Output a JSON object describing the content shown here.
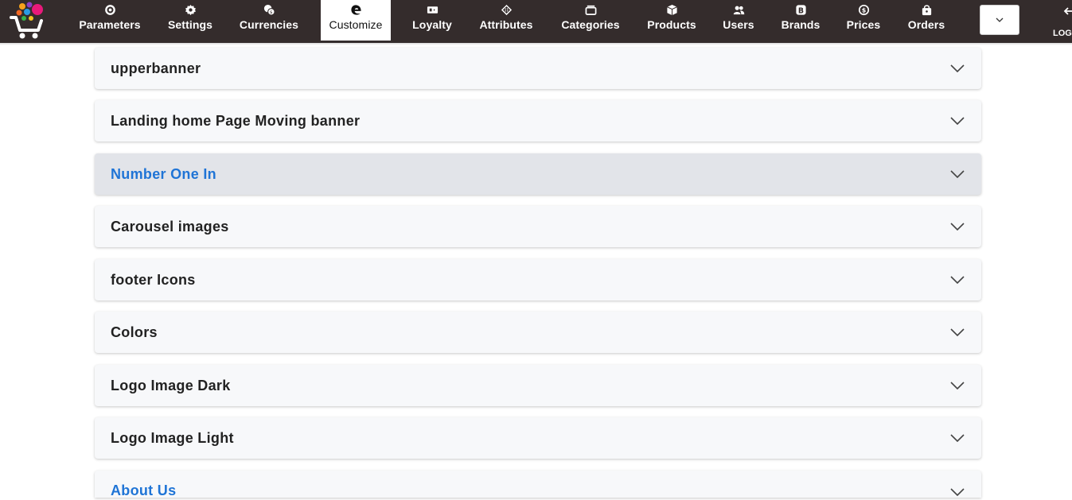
{
  "nav": {
    "items": [
      {
        "label": "Parameters",
        "icon": "parameters-icon"
      },
      {
        "label": "Settings",
        "icon": "gear-icon"
      },
      {
        "label": "Currencies",
        "icon": "coins-icon"
      },
      {
        "label": "Customize",
        "icon": "edge-icon",
        "active": true
      },
      {
        "label": "Loyalty",
        "icon": "ticket-icon"
      },
      {
        "label": "Attributes",
        "icon": "diamond-grid-icon"
      },
      {
        "label": "Categories",
        "icon": "box-stack-icon"
      },
      {
        "label": "Products",
        "icon": "cube-icon"
      },
      {
        "label": "Users",
        "icon": "users-icon"
      },
      {
        "label": "Brands",
        "icon": "b-badge-icon"
      },
      {
        "label": "Prices",
        "icon": "dollar-circle-icon"
      },
      {
        "label": "Orders",
        "icon": "shopping-bag-icon"
      }
    ],
    "logout_label": "LOG",
    "colors": {
      "bar": "#342c2c",
      "active_bg": "#ffffff"
    }
  },
  "sections": [
    {
      "title": "upperbanner"
    },
    {
      "title": "Landing home Page Moving banner"
    },
    {
      "title": "Number One In",
      "active": true
    },
    {
      "title": "Carousel images"
    },
    {
      "title": "footer Icons"
    },
    {
      "title": "Colors"
    },
    {
      "title": "Logo Image Dark"
    },
    {
      "title": "Logo Image Light"
    },
    {
      "title": "About Us",
      "highlight": true
    }
  ],
  "colors": {
    "accent_blue": "#1f74d6",
    "accordion_bg": "#f7f8fa",
    "accordion_active_bg": "#e2e4e9"
  }
}
